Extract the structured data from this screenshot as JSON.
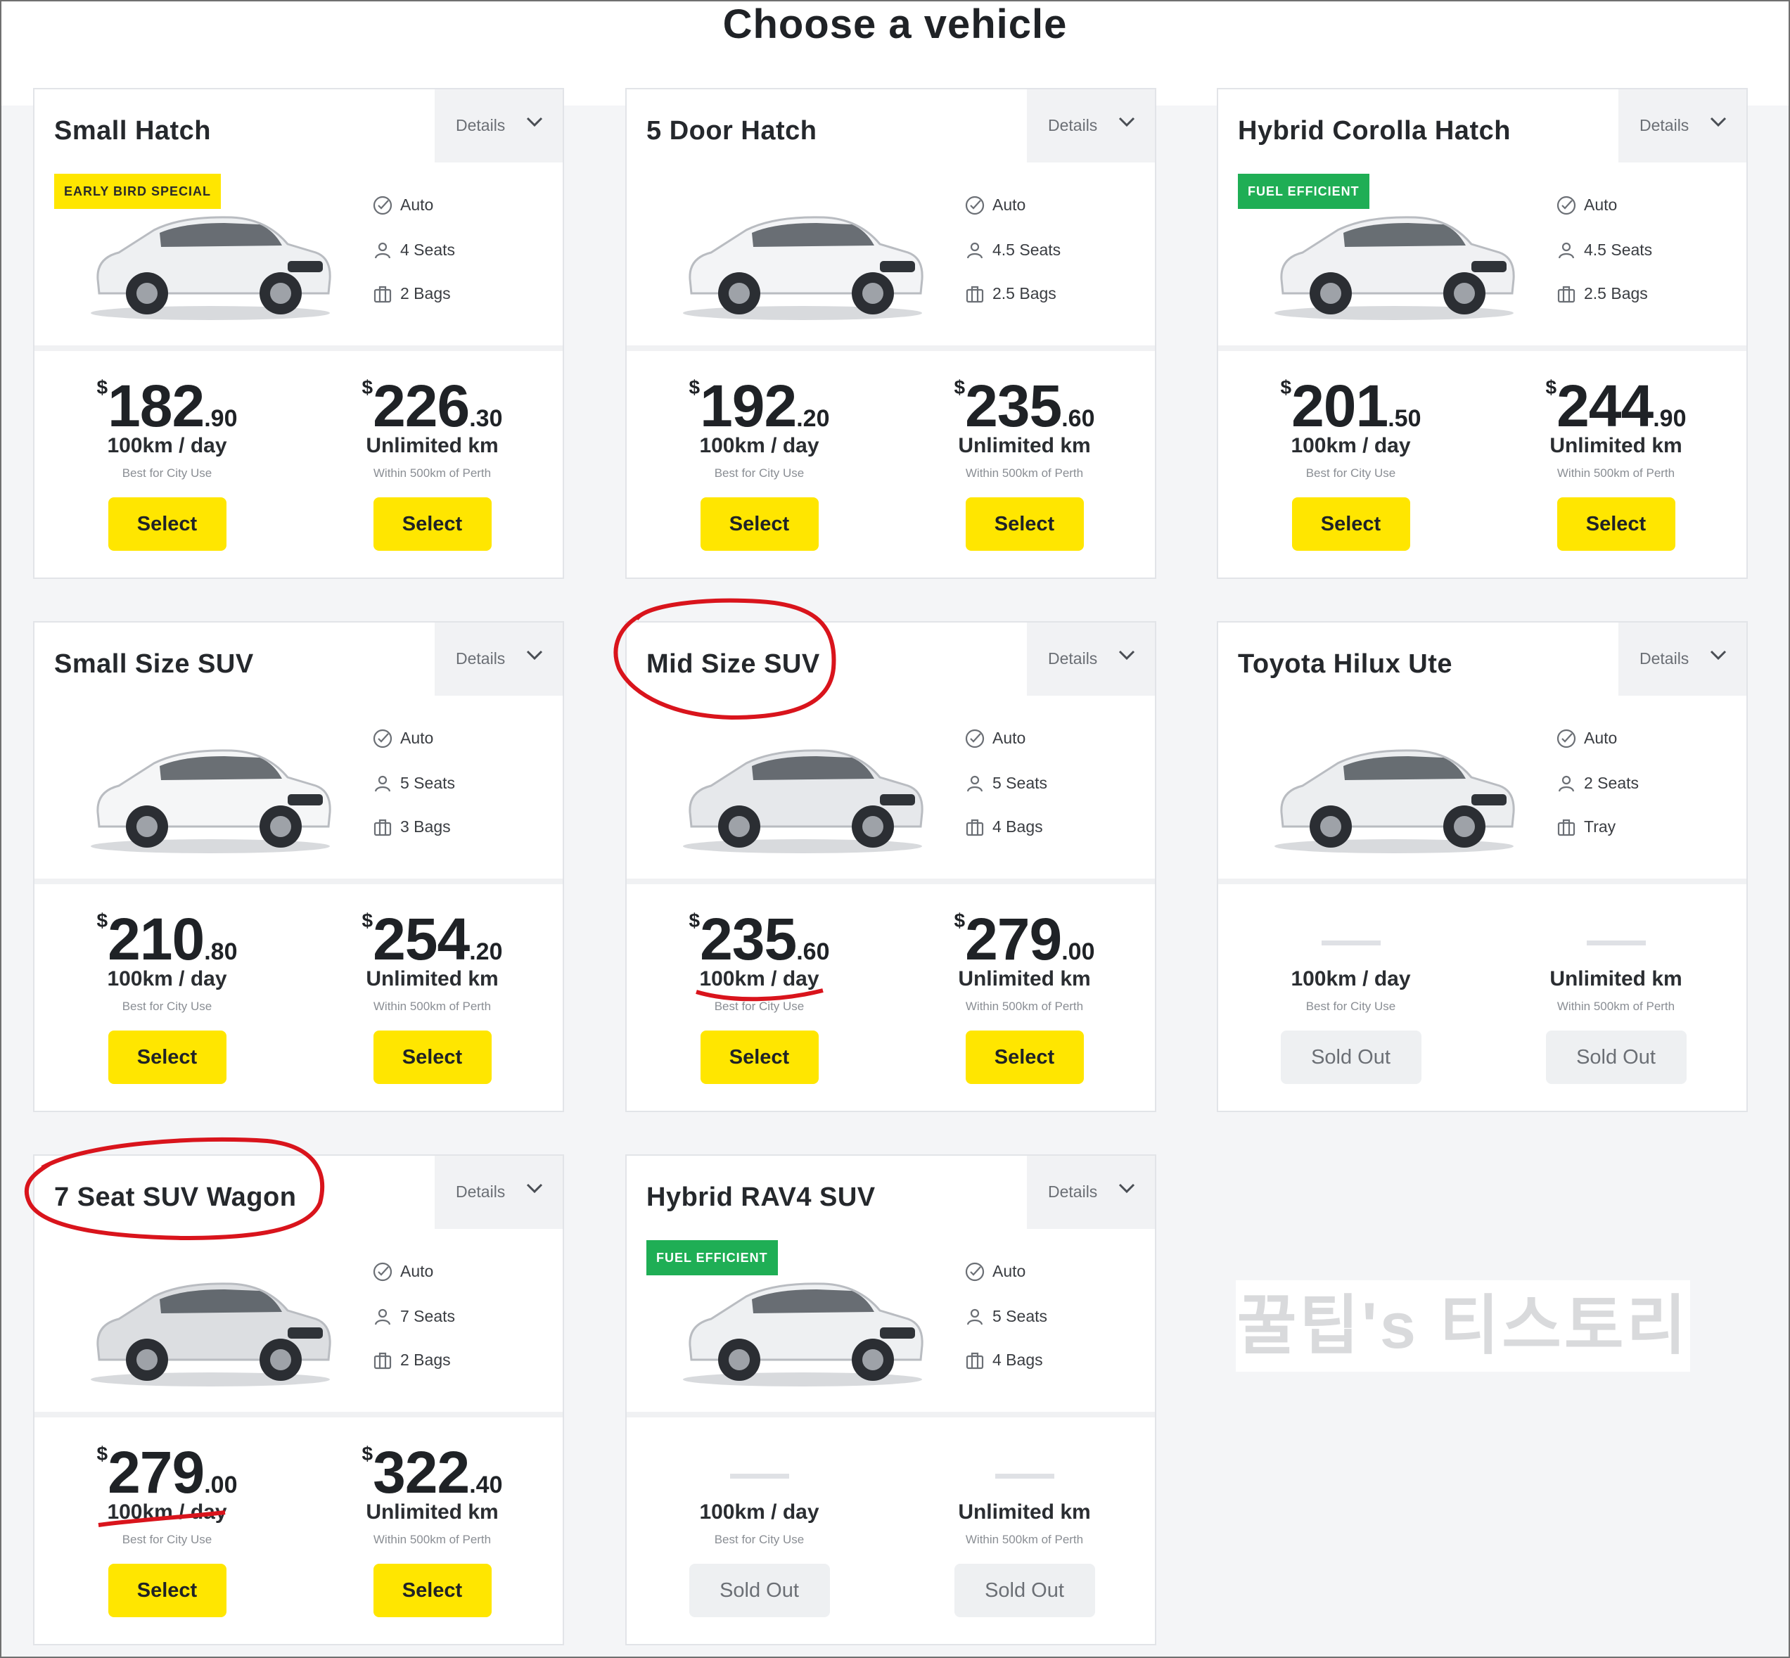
{
  "page_title": "Choose a vehicle",
  "details_label": "Details",
  "specs": {
    "transmission": "Auto"
  },
  "plans": {
    "limited": {
      "label": "100km / day",
      "sub": "Best for City Use"
    },
    "unlimited": {
      "label": "Unlimited km",
      "sub": "Within 500km of Perth"
    }
  },
  "currency_symbol": "$",
  "select_label": "Select",
  "soldout_label": "Sold Out",
  "colors": {
    "accent": "#ffe600",
    "badge_green": "#1fae55",
    "annotation": "#d9141c"
  },
  "cards": [
    {
      "name": "Small Hatch",
      "badge": "EARLY BIRD SPECIAL",
      "badge_color": "yellow",
      "seats": "4 Seats",
      "bags": "2 Bags",
      "car_color": "#eef0f2",
      "limited": {
        "whole": "182",
        "cents": ".90"
      },
      "unlimited": {
        "whole": "226",
        "cents": ".30"
      }
    },
    {
      "name": "5 Door Hatch",
      "seats": "4.5 Seats",
      "bags": "2.5 Bags",
      "car_color": "#f3f4f6",
      "limited": {
        "whole": "192",
        "cents": ".20"
      },
      "unlimited": {
        "whole": "235",
        "cents": ".60"
      }
    },
    {
      "name": "Hybrid Corolla Hatch",
      "badge": "FUEL EFFICIENT",
      "badge_color": "green",
      "seats": "4.5 Seats",
      "bags": "2.5 Bags",
      "car_color": "#f0f1f3",
      "limited": {
        "whole": "201",
        "cents": ".50"
      },
      "unlimited": {
        "whole": "244",
        "cents": ".90"
      }
    },
    {
      "name": "Small Size SUV",
      "seats": "5 Seats",
      "bags": "3 Bags",
      "car_color": "#f5f6f7",
      "limited": {
        "whole": "210",
        "cents": ".80"
      },
      "unlimited": {
        "whole": "254",
        "cents": ".20"
      }
    },
    {
      "name": "Mid Size SUV",
      "seats": "5 Seats",
      "bags": "4 Bags",
      "car_color": "#e6e8eb",
      "limited": {
        "whole": "235",
        "cents": ".60"
      },
      "unlimited": {
        "whole": "279",
        "cents": ".00"
      }
    },
    {
      "name": "Toyota Hilux Ute",
      "seats": "2 Seats",
      "bags": "Tray",
      "car_color": "#eceef0",
      "sold_out": true
    },
    {
      "name": "7 Seat SUV Wagon",
      "seats": "7 Seats",
      "bags": "2 Bags",
      "car_color": "#dcdee1",
      "limited": {
        "whole": "279",
        "cents": ".00"
      },
      "unlimited": {
        "whole": "322",
        "cents": ".40"
      }
    },
    {
      "name": "Hybrid RAV4 SUV",
      "badge": "FUEL EFFICIENT",
      "badge_color": "green",
      "seats": "5 Seats",
      "bags": "4 Bags",
      "car_color": "#eef0f2",
      "sold_out": true
    }
  ],
  "watermark": "꿀팁's 티스토리"
}
